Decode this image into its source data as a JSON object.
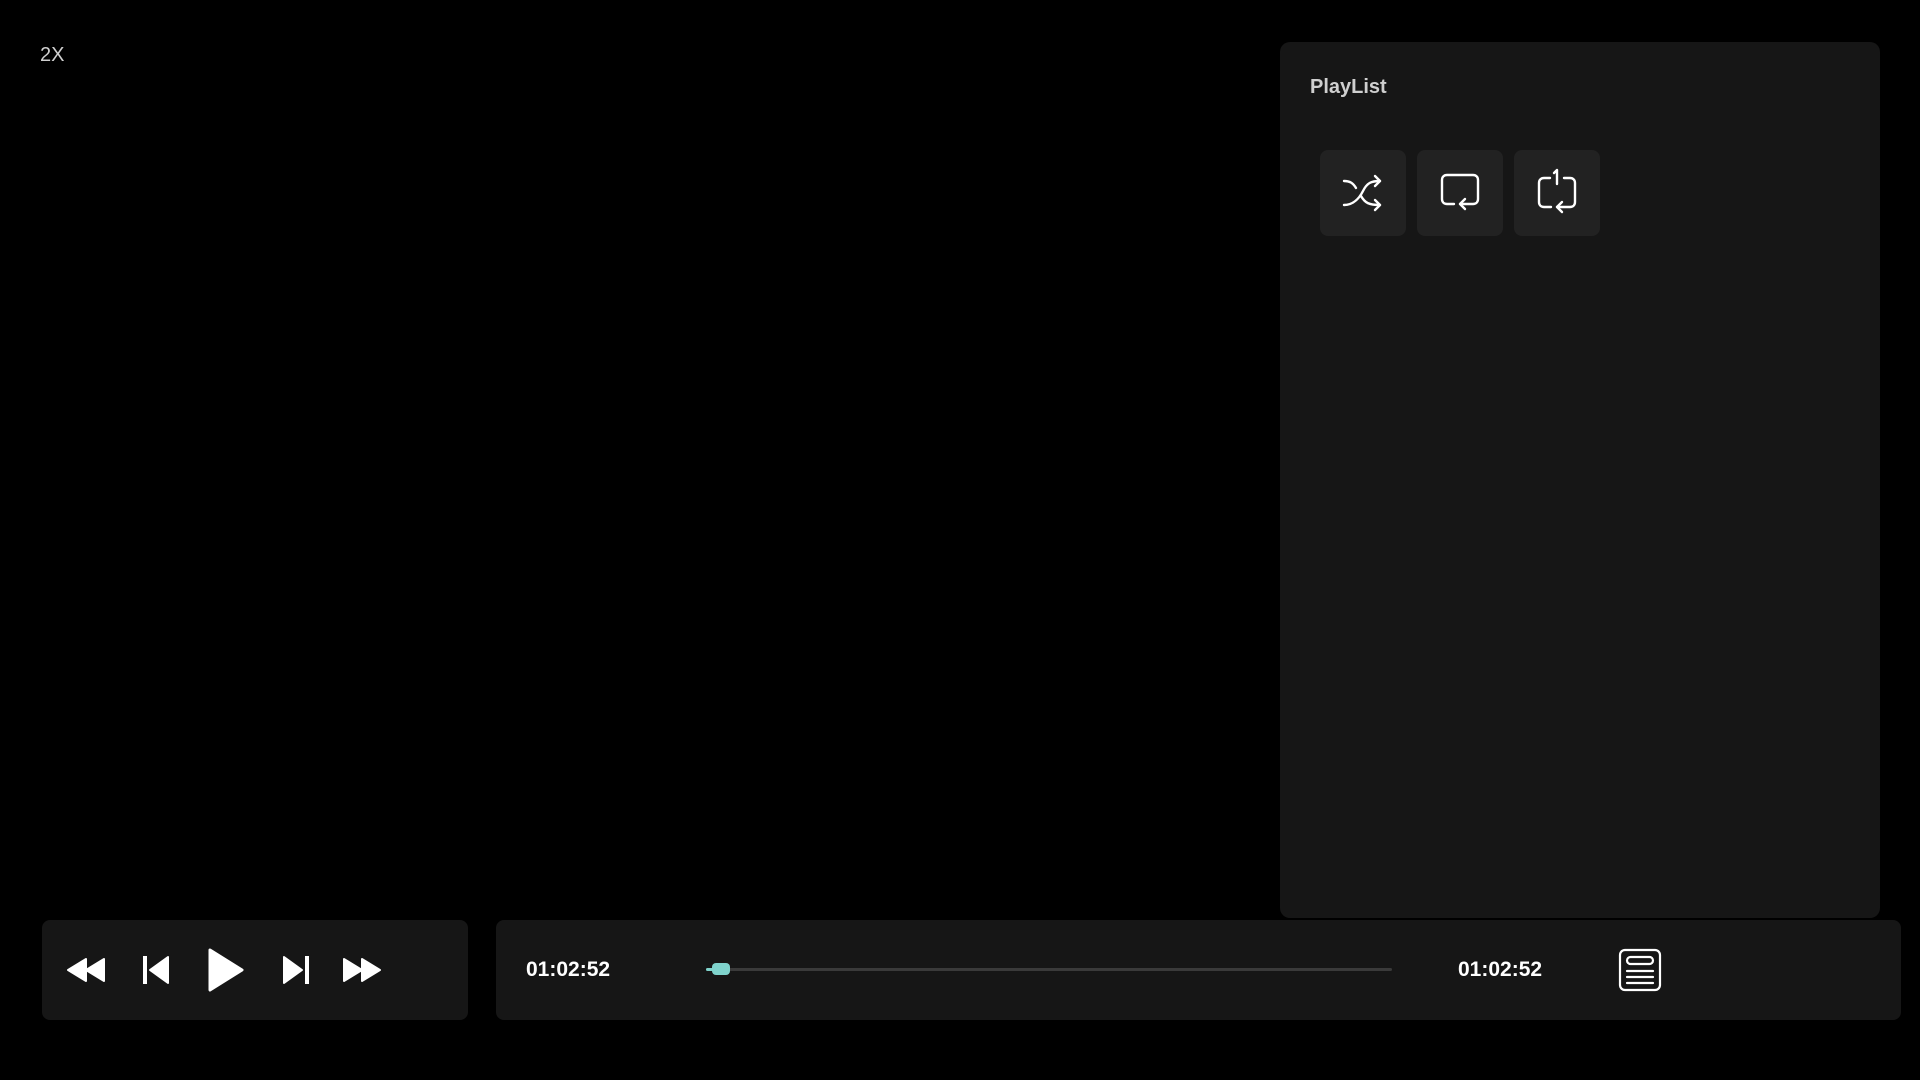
{
  "playback_speed": "2X",
  "playlist": {
    "title": "PlayList",
    "modes": [
      {
        "icon": "shuffle-icon"
      },
      {
        "icon": "repeat-all-icon"
      },
      {
        "icon": "repeat-one-icon"
      }
    ]
  },
  "transport": {
    "buttons": [
      "rewind-icon",
      "previous-icon",
      "play-icon",
      "next-icon",
      "fast-forward-icon"
    ]
  },
  "timeline": {
    "current_time": "01:02:52",
    "total_time": "01:02:52",
    "progress_fraction": 0.01
  },
  "colors": {
    "accent": "#7fd3cc",
    "panel": "#161616",
    "button": "#222222",
    "background": "#000000"
  },
  "icons": {
    "playlist_toggle": "playlist-icon"
  }
}
